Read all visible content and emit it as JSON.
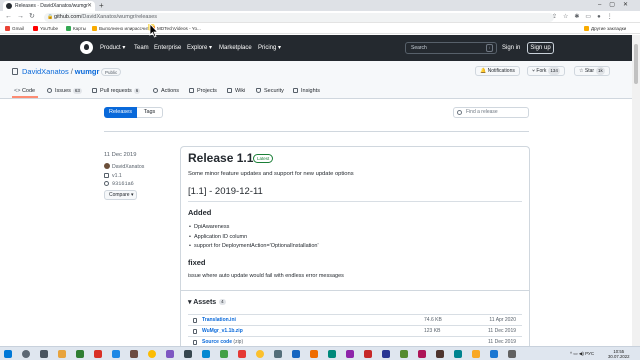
{
  "browser": {
    "tab_title": "Releases · DavidXanatos/wumgr",
    "new_tab": "+",
    "url_host": "github.com",
    "url_path": "/DavidXanatos/wumgr/releases",
    "bookmarks": [
      "Gmail",
      "YouTube",
      "Карты",
      "Выполнено илирассчит...",
      "MDTechVideos - Yo..."
    ],
    "other_bookmarks": "Другие закладки"
  },
  "gh_header": {
    "nav": [
      "Product ▾",
      "Team",
      "Enterprise",
      "Explore ▾",
      "Marketplace",
      "Pricing ▾"
    ],
    "search_placeholder": "Search",
    "search_key": "/",
    "sign_in": "Sign in",
    "sign_up": "Sign up"
  },
  "repo": {
    "owner": "DavidXanatos",
    "separator": "/",
    "name": "wumgr",
    "visibility": "Public",
    "notifications": "Notifications",
    "fork_label": "Fork",
    "fork_count": "134",
    "star_label": "Star",
    "star_count": "1k",
    "tabs": [
      {
        "label": "Code",
        "count": ""
      },
      {
        "label": "Issues",
        "count": "63"
      },
      {
        "label": "Pull requests",
        "count": "6"
      },
      {
        "label": "Actions",
        "count": ""
      },
      {
        "label": "Projects",
        "count": ""
      },
      {
        "label": "Wiki",
        "count": ""
      },
      {
        "label": "Security",
        "count": ""
      },
      {
        "label": "Insights",
        "count": ""
      }
    ]
  },
  "releases_page": {
    "releases_button": "Releases",
    "tags_button": "Tags",
    "find_placeholder": "Find a release"
  },
  "release": {
    "date": "11 Dec 2019",
    "author": "DavidXanatos",
    "tag": "v1.1",
    "commit": "93161a6",
    "compare": "Compare ▾",
    "title": "Release 1.1",
    "latest_badge": "Latest",
    "summary": "Some minor feature updates and support for new update options",
    "heading": "[1.1] - 2019-12-11",
    "added_heading": "Added",
    "added_items": [
      "DpiAwareness",
      "Application ID column",
      "support for DeploymentAction='OptionalInstallation'"
    ],
    "fixed_heading": "fixed",
    "fixed_text": "issue where auto update would fail with endless error messages",
    "assets_heading": "Assets",
    "assets_count": "4",
    "assets": [
      {
        "name": "Translation.ini",
        "format": "",
        "size": "74.6 KB",
        "date": "11 Apr 2020"
      },
      {
        "name": "WuMgr_v1.1b.zip",
        "format": "",
        "size": "123 KB",
        "date": "11 Dec 2019"
      },
      {
        "name": "Source code",
        "format": "(zip)",
        "size": "",
        "date": "11 Dec 2019"
      }
    ]
  },
  "taskbar": {
    "lang": "РУС",
    "time": "10:55",
    "date": "30.07.2022"
  },
  "colors": {
    "github_header": "#24292f",
    "link_blue": "#0969da",
    "primary_button": "#0969da",
    "latest_green": "#1a7f37",
    "tab_underline": "#fd8c73"
  }
}
